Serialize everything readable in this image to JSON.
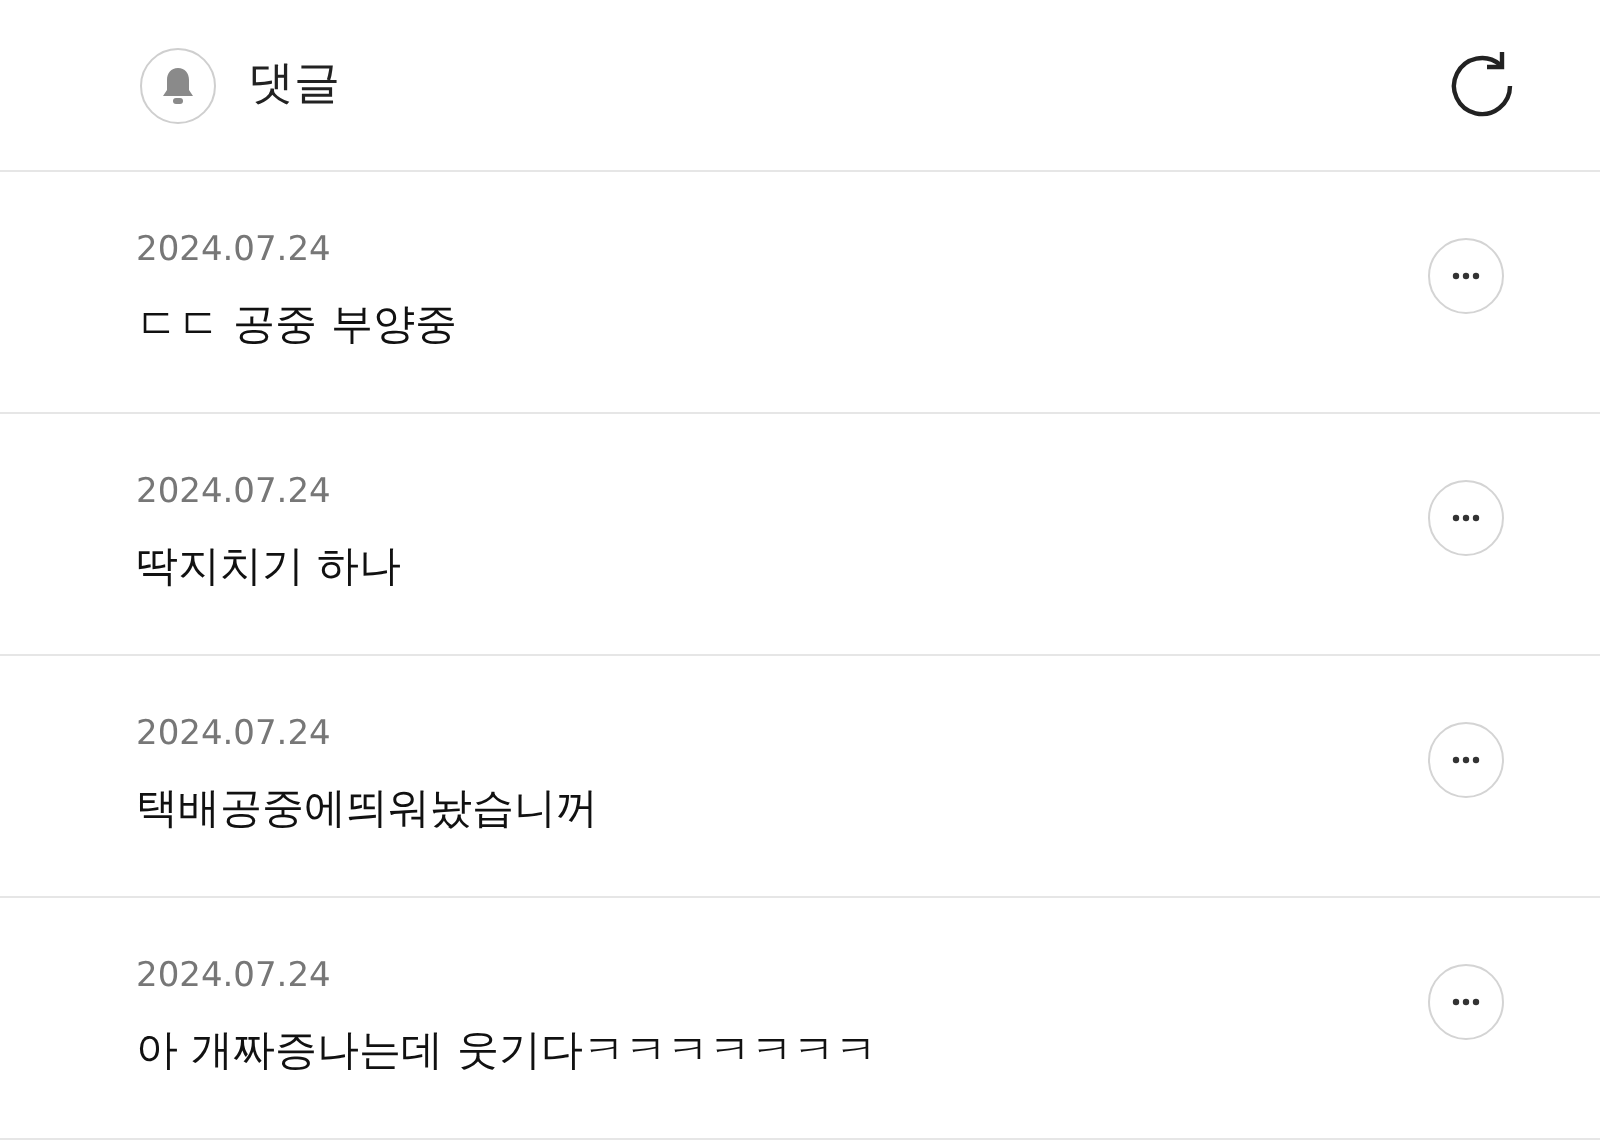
{
  "header": {
    "title": "댓글"
  },
  "comments": [
    {
      "date": "2024.07.24",
      "text": "ㄷㄷ 공중 부양중"
    },
    {
      "date": "2024.07.24",
      "text": "딱지치기 하나"
    },
    {
      "date": "2024.07.24",
      "text": "택배공중에띄워놨습니꺼"
    },
    {
      "date": "2024.07.24",
      "text": "아 개짜증나는데 웃기다ㅋㅋㅋㅋㅋㅋㅋ"
    }
  ]
}
